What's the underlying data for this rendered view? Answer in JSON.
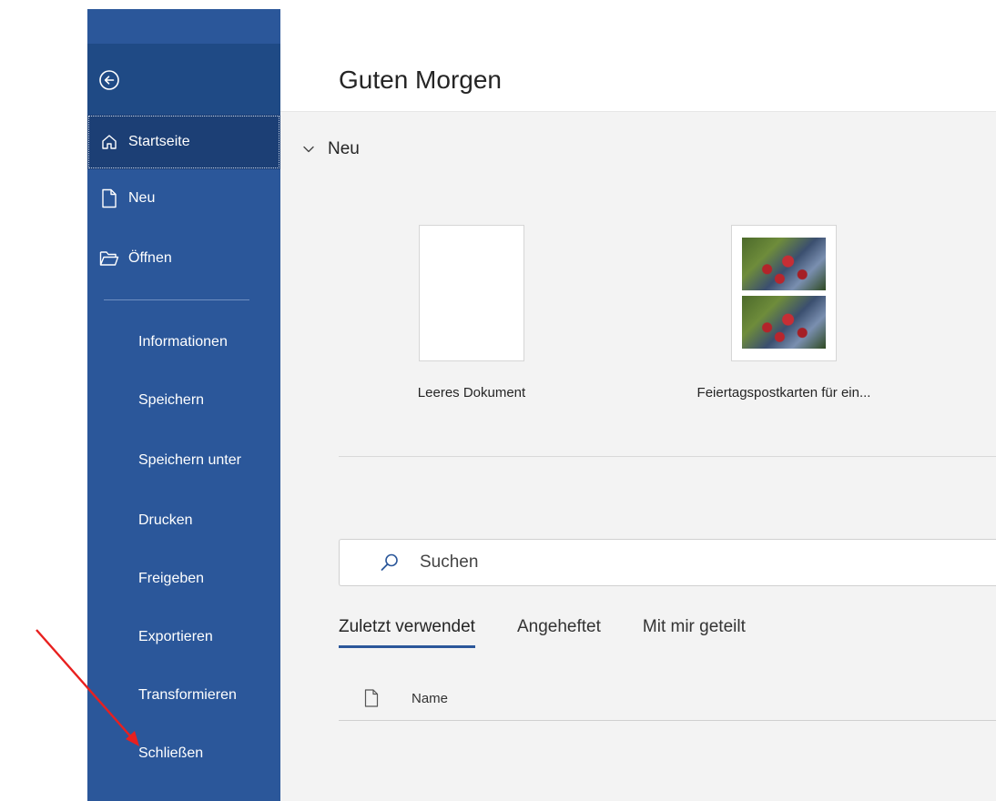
{
  "header": {
    "greeting": "Guten Morgen"
  },
  "sidebar": {
    "items": [
      {
        "label": "Startseite",
        "icon": "home-icon",
        "selected": true
      },
      {
        "label": "Neu",
        "icon": "new-document-icon"
      },
      {
        "label": "Öffnen",
        "icon": "open-folder-icon"
      },
      {
        "label": "Informationen"
      },
      {
        "label": "Speichern"
      },
      {
        "label": "Speichern unter"
      },
      {
        "label": "Drucken"
      },
      {
        "label": "Freigeben"
      },
      {
        "label": "Exportieren"
      },
      {
        "label": "Transformieren"
      },
      {
        "label": "Schließen"
      }
    ]
  },
  "new_section": {
    "title": "Neu",
    "templates": [
      {
        "label": "Leeres Dokument"
      },
      {
        "label": "Feiertagspostkarten für ein..."
      }
    ]
  },
  "search": {
    "placeholder": "Suchen"
  },
  "tabs": [
    {
      "label": "Zuletzt verwendet",
      "active": true
    },
    {
      "label": "Angeheftet"
    },
    {
      "label": "Mit mir geteilt"
    }
  ],
  "file_list": {
    "column_name": "Name"
  },
  "colors": {
    "sidebar": "#2b579a",
    "selected": "#1c3f75",
    "accent": "#2b579a",
    "annotation_arrow": "#e8201f"
  }
}
